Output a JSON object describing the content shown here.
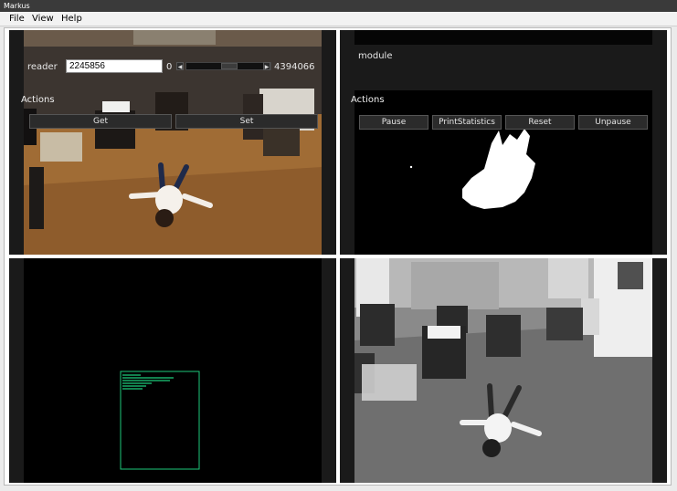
{
  "window": {
    "title": "Markus"
  },
  "menu": {
    "file": "File",
    "view": "View",
    "help": "Help"
  },
  "reader_panel": {
    "label": "reader",
    "value": "2245856",
    "slider_min": "0",
    "slider_max": "4394066",
    "slider_position": 0.51,
    "actions_label": "Actions",
    "buttons": {
      "get": "Get",
      "set": "Set"
    }
  },
  "module_panel": {
    "label": "module",
    "actions_label": "Actions",
    "buttons": {
      "pause": "Pause",
      "print_statistics": "PrintStatistics",
      "reset": "Reset",
      "unpause": "Unpause"
    }
  },
  "icons": {
    "slider_left": "arrow-left-icon",
    "slider_right": "arrow-right-icon"
  },
  "colors": {
    "overlay_green": "#1ec97a",
    "panel_bg": "#1a1a1a",
    "floor": "#a06c35"
  }
}
